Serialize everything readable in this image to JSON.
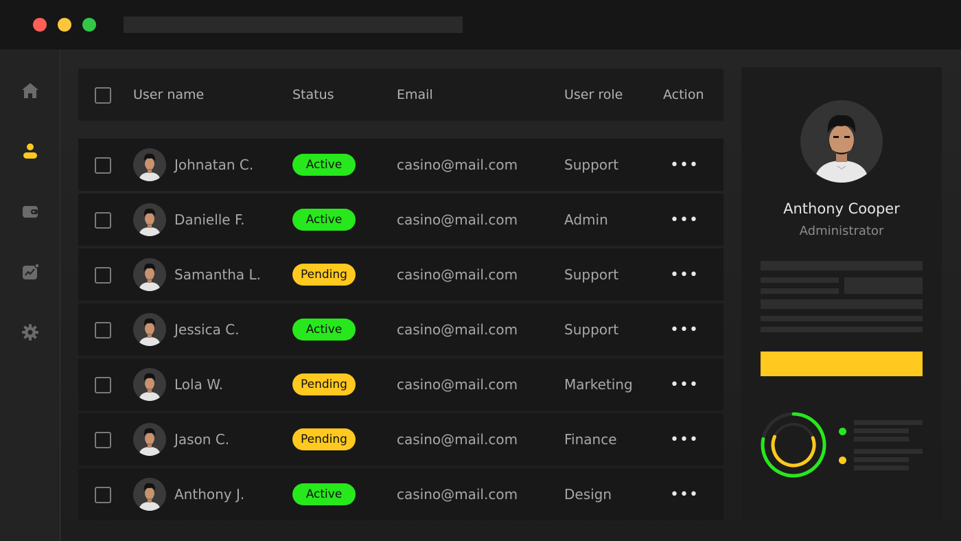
{
  "table": {
    "headers": {
      "username": "User name",
      "status": "Status",
      "email": "Email",
      "role": "User role",
      "action": "Action"
    },
    "rows": [
      {
        "name": "Johnatan C.",
        "status": "Active",
        "email": "casino@mail.com",
        "role": "Support"
      },
      {
        "name": "Danielle F.",
        "status": "Active",
        "email": "casino@mail.com",
        "role": "Admin"
      },
      {
        "name": "Samantha L.",
        "status": "Pending",
        "email": "casino@mail.com",
        "role": "Support"
      },
      {
        "name": "Jessica C.",
        "status": "Active",
        "email": "casino@mail.com",
        "role": "Support"
      },
      {
        "name": "Lola W.",
        "status": "Pending",
        "email": "casino@mail.com",
        "role": "Marketing"
      },
      {
        "name": "Jason C.",
        "status": "Pending",
        "email": "casino@mail.com",
        "role": "Finance"
      },
      {
        "name": "Anthony J.",
        "status": "Active",
        "email": "casino@mail.com",
        "role": "Design"
      }
    ],
    "action_glyph": "•••"
  },
  "profile": {
    "name": "Anthony Cooper",
    "role": "Administrator"
  },
  "sidebar": {
    "icons": [
      "home-icon",
      "user-icon",
      "wallet-icon",
      "chart-icon",
      "gear-icon"
    ]
  },
  "colors": {
    "active": "#27e81c",
    "pending": "#ffc91f",
    "accent": "#ffc91f"
  },
  "ring": {
    "outer_fraction": 0.78,
    "inner_fraction": 0.62
  }
}
